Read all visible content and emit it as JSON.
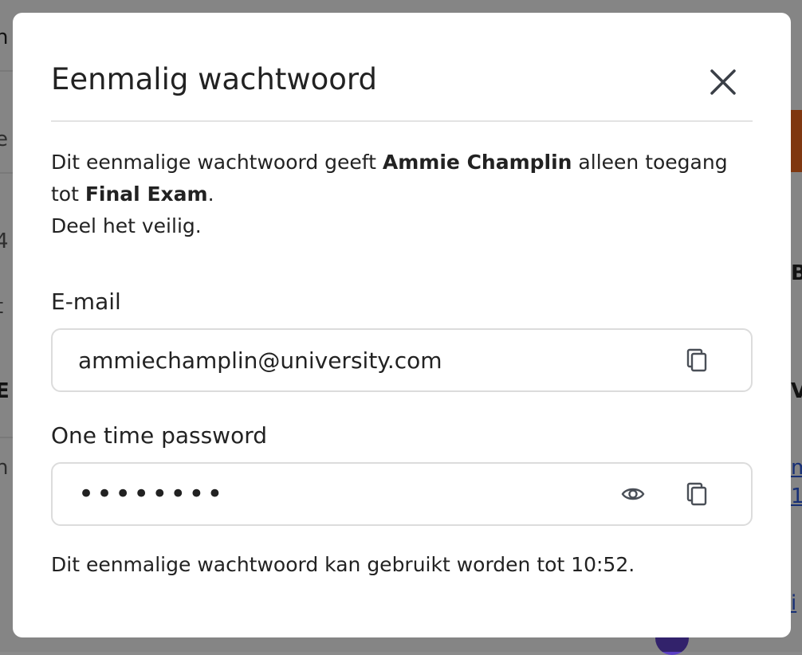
{
  "modal": {
    "title": "Eenmalig wachtwoord",
    "description": {
      "part1": "Dit eenmalige wachtwoord geeft ",
      "user_name": "Ammie Champlin",
      "part2": " alleen toegang tot ",
      "exam_name": "Final Exam",
      "part3": ".",
      "line2": "Deel het veilig."
    },
    "email": {
      "label": "E-mail",
      "value": "ammiechamplin@university.com"
    },
    "password": {
      "label": "One time password",
      "value": "••••••••"
    },
    "note": "Dit eenmalige wachtwoord kan gebruikt worden tot 10:52."
  },
  "icons": {
    "close": "close-icon",
    "copy": "copy-icon",
    "eye": "eye-icon"
  },
  "colors": {
    "text": "#222222",
    "border": "#dcdcdc",
    "icon": "#4a4f57"
  }
}
